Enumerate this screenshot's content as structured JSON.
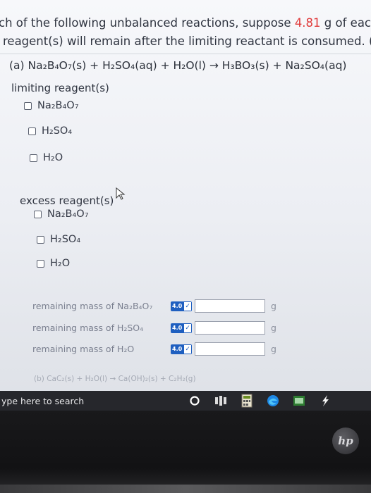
{
  "header": {
    "line1_pre": "ch of the following unbalanced reactions, suppose ",
    "line1_mass": "4.81",
    "line1_post": " g of each reac",
    "line2": "reagent(s) will remain after the limiting reactant is consumed. (Selec"
  },
  "part_a": {
    "equation": "(a) Na₂B₄O₇(s) + H₂SO₄(aq) + H₂O(l) → H₃BO₃(s) + Na₂SO₄(aq)",
    "limiting_label": "limiting reagent(s)",
    "limiting_options": [
      "Na₂B₄O₇",
      "H₂SO₄",
      "H₂O"
    ],
    "excess_label": "excess reagent(s)",
    "excess_options": [
      "Na₂B₄O₇",
      "H₂SO₄",
      "H₂O"
    ],
    "mass_rows": [
      {
        "label": "remaining mass of Na₂B₄O₇",
        "badge": "4.0",
        "unit": "g",
        "value": ""
      },
      {
        "label": "remaining mass of H₂SO₄",
        "badge": "4.0",
        "unit": "g",
        "value": ""
      },
      {
        "label": "remaining mass of H₂O",
        "badge": "4.0",
        "unit": "g",
        "value": ""
      }
    ]
  },
  "part_b": {
    "equation": "(b) CaC₂(s) + H₂O(l) → Ca(OH)₂(s) + C₂H₂(g)"
  },
  "taskbar": {
    "search_text": "ype here to search"
  },
  "colors": {
    "accent": "#e03a3a",
    "badge": "#1f5fc0",
    "taskbar": "#26272c"
  },
  "icons": [
    "cortana-circle-icon",
    "task-view-icon",
    "calculator-icon",
    "edge-icon",
    "files-icon",
    "app-icon"
  ],
  "logo_text": "hp"
}
